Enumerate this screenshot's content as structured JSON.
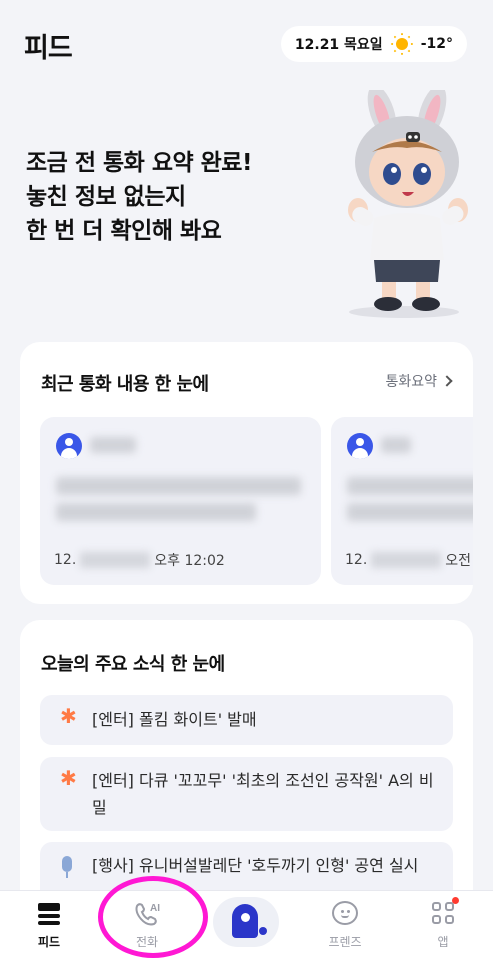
{
  "header": {
    "title": "피드",
    "date": "12.21 목요일",
    "temperature": "-12°",
    "weather_icon": "sun-icon"
  },
  "hero": {
    "line1": "조금 전 통화 요약 완료!",
    "line2": "놓친 정보 없는지",
    "line3": "한 번 더 확인해 봐요"
  },
  "recent_calls": {
    "title": "최근 통화 내용 한 눈에",
    "link_label": "통화요약",
    "cards": [
      {
        "date_prefix": "12.",
        "time": "오후 12:02"
      },
      {
        "date_prefix": "12.",
        "time": "오전"
      }
    ]
  },
  "news": {
    "title": "오늘의 주요 소식 한 눈에",
    "items": [
      {
        "text": "[엔터] 폴킴 화이트' 발매",
        "icon": "asterisk-icon"
      },
      {
        "text": "[엔터] 다큐 '꼬꼬무' '최초의 조선인 공작원' A의 비밀",
        "icon": "asterisk-icon"
      },
      {
        "text": "[행사] 유니버설발레단 '호두까기 인형' 공연 실시",
        "icon": "microphone-icon"
      }
    ]
  },
  "bottom_nav": {
    "items": [
      {
        "label": "피드",
        "icon": "feed-icon",
        "active": true
      },
      {
        "label": "전화",
        "icon": "phone-ai-icon",
        "badge": "AI"
      },
      {
        "label": "",
        "icon": "adot-logo-icon"
      },
      {
        "label": "프렌즈",
        "icon": "chat-face-icon"
      },
      {
        "label": "앱",
        "icon": "apps-grid-icon"
      }
    ]
  },
  "colors": {
    "background": "#f3f4f8",
    "accent": "#2b36c9",
    "highlight": "#ff18d4",
    "news_asterisk": "#ff7a45"
  }
}
